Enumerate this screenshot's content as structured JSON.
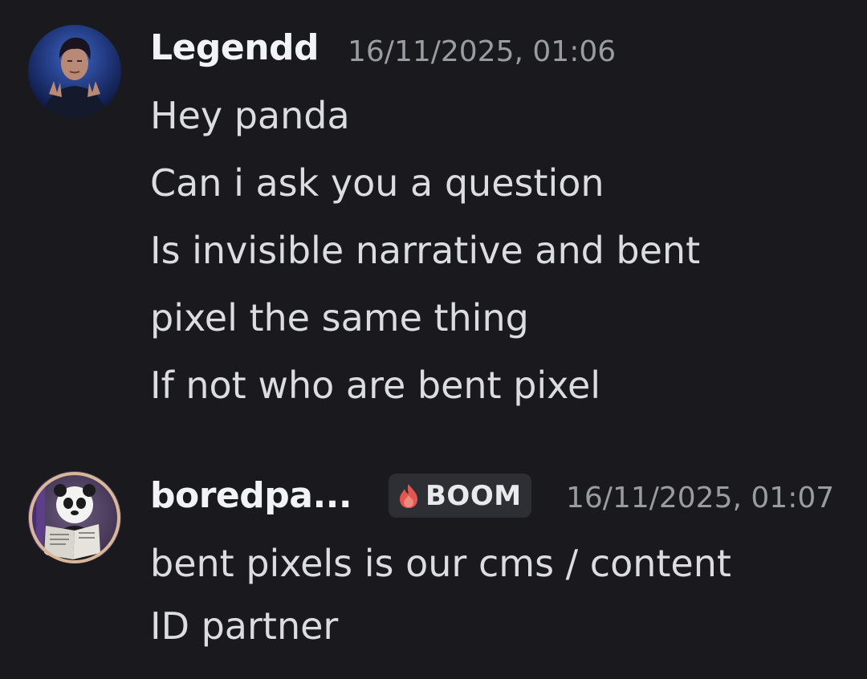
{
  "messages": [
    {
      "username": "Legendd",
      "timestamp": "16/11/2025, 01:06",
      "avatar_icon": "person-portrait-avatar",
      "lines": [
        "Hey panda",
        "Can i ask you a question",
        "Is invisible narrative and bent",
        "pixel the same thing",
        "If not who are bent pixel"
      ]
    },
    {
      "username": "boredpa...",
      "timestamp": "16/11/2025, 01:07",
      "avatar_icon": "panda-reading-newspaper-avatar",
      "tag": {
        "icon": "flame-icon",
        "label": "BOOM"
      },
      "lines": [
        "bent pixels is our cms / content",
        "ID partner"
      ]
    }
  ],
  "colors": {
    "background": "#1a1a1e",
    "username": "#f2f3f5",
    "text": "#dcdde1",
    "timestamp": "#9a9ca3",
    "tag_background": "#2e2f35",
    "tag_icon": "#e2564f"
  }
}
